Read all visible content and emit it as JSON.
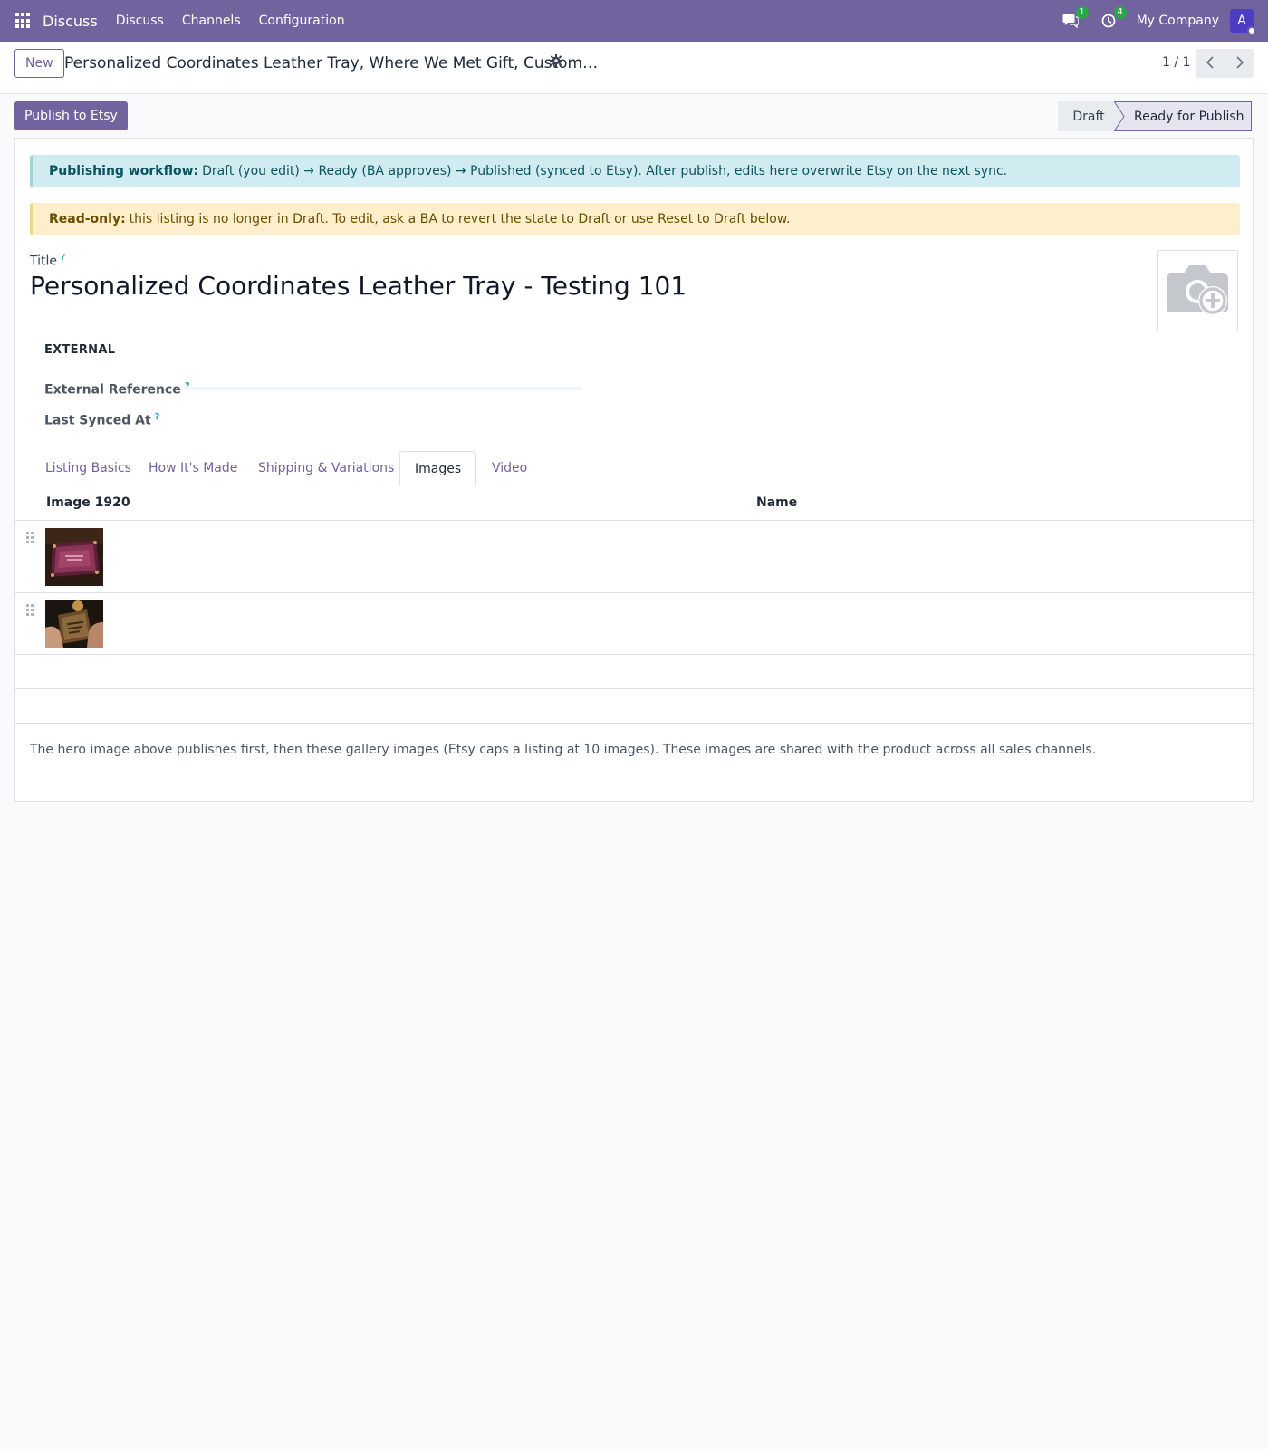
{
  "navbar": {
    "brand": "Discuss",
    "menu": [
      "Discuss",
      "Channels",
      "Configuration"
    ],
    "messages_badge": "1",
    "activities_badge": "4",
    "company": "My Company",
    "avatar_initial": "A",
    "color": "#71639e"
  },
  "control_panel": {
    "new_label": "New",
    "record_title": "Personalized Coordinates Leather Tray, Where We Met Gift, Custom…",
    "pager": "1 / 1"
  },
  "statusbar": {
    "publish_button": "Publish to Etsy",
    "stages": [
      "Draft",
      "Ready for Publish"
    ],
    "active_stage": "Ready for Publish"
  },
  "alerts": {
    "info_bold": "Publishing workflow:",
    "info_text": "Draft (you edit) → Ready (BA approves) → Published (synced to Etsy). After publish, edits here overwrite Etsy on the next sync.",
    "warning_bold": "Read-only:",
    "warning_text": "this listing is no longer in Draft. To edit, ask a BA to revert the state to Draft or use Reset to Draft below."
  },
  "form": {
    "title_label": "Title",
    "help_mark": "?",
    "title_value": "Personalized Coordinates Leather Tray - Testing 101",
    "group_heading": "EXTERNAL",
    "external_reference_label": "External Reference",
    "last_synced_label": "Last Synced At"
  },
  "tabs": [
    {
      "label": "Listing Basics",
      "active": false
    },
    {
      "label": "How It's Made",
      "active": false
    },
    {
      "label": "Shipping & Variations",
      "active": false
    },
    {
      "label": "Images",
      "active": true
    },
    {
      "label": "Video",
      "active": false
    }
  ],
  "images_table": {
    "columns": [
      "Image 1920",
      "Name"
    ],
    "rows": [
      {
        "image": "leather-tray-pink-thumbnail",
        "name": ""
      },
      {
        "image": "leather-tray-hands-thumbnail",
        "name": ""
      }
    ]
  },
  "note": "The hero image above publishes first, then these gallery images (Etsy caps a listing at 10 images). These images are shared with the product across all sales channels."
}
